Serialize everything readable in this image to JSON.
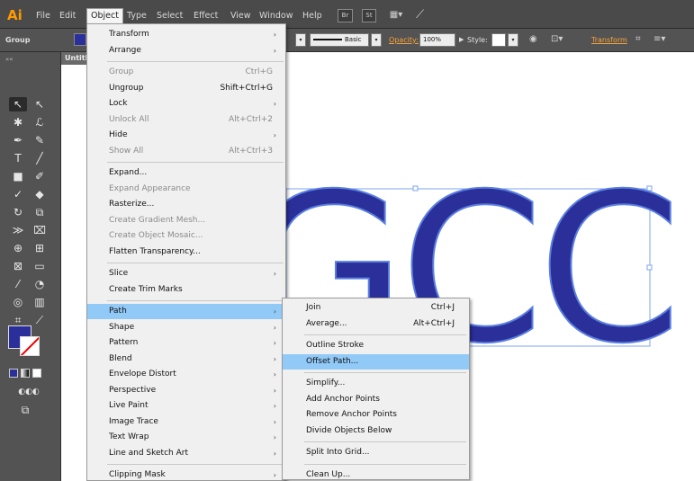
{
  "app": {
    "logo": "Ai"
  },
  "menubar": {
    "items": [
      "File",
      "Edit",
      "Object",
      "Type",
      "Select",
      "Effect",
      "View",
      "Window",
      "Help"
    ],
    "active": "Object",
    "bridge_label": "Br",
    "stock_label": "St",
    "arrange_label": "▦▾",
    "brush_icon": "feather-icon"
  },
  "controlbar": {
    "selection_type": "Group",
    "stroke_style_label": "Basic",
    "opacity_label": "Opacity:",
    "opacity_value": "100%",
    "style_label": "Style:",
    "transform_label": "Transform"
  },
  "document": {
    "tab_title": "Untitled"
  },
  "artwork": {
    "text": "GCC",
    "fill_color": "#2b2f99",
    "stroke_color": "#5a7fe0"
  },
  "object_menu": {
    "items": [
      {
        "label": "Transform",
        "submenu": true
      },
      {
        "label": "Arrange",
        "submenu": true
      },
      {
        "separator": true
      },
      {
        "label": "Group",
        "shortcut": "Ctrl+G",
        "disabled": true
      },
      {
        "label": "Ungroup",
        "shortcut": "Shift+Ctrl+G"
      },
      {
        "label": "Lock",
        "submenu": true
      },
      {
        "label": "Unlock All",
        "shortcut": "Alt+Ctrl+2",
        "disabled": true
      },
      {
        "label": "Hide",
        "submenu": true
      },
      {
        "label": "Show All",
        "shortcut": "Alt+Ctrl+3",
        "disabled": true
      },
      {
        "separator": true
      },
      {
        "label": "Expand..."
      },
      {
        "label": "Expand Appearance",
        "disabled": true
      },
      {
        "label": "Rasterize..."
      },
      {
        "label": "Create Gradient Mesh...",
        "disabled": true
      },
      {
        "label": "Create Object Mosaic...",
        "disabled": true
      },
      {
        "label": "Flatten Transparency..."
      },
      {
        "separator": true
      },
      {
        "label": "Slice",
        "submenu": true
      },
      {
        "label": "Create Trim Marks"
      },
      {
        "separator": true
      },
      {
        "label": "Path",
        "submenu": true,
        "highlight": true
      },
      {
        "label": "Shape",
        "submenu": true
      },
      {
        "label": "Pattern",
        "submenu": true
      },
      {
        "label": "Blend",
        "submenu": true
      },
      {
        "label": "Envelope Distort",
        "submenu": true
      },
      {
        "label": "Perspective",
        "submenu": true
      },
      {
        "label": "Live Paint",
        "submenu": true
      },
      {
        "label": "Image Trace",
        "submenu": true
      },
      {
        "label": "Text Wrap",
        "submenu": true
      },
      {
        "label": "Line and Sketch Art",
        "submenu": true
      },
      {
        "separator": true
      },
      {
        "label": "Clipping Mask",
        "submenu": true
      }
    ]
  },
  "path_submenu": {
    "items": [
      {
        "label": "Join",
        "shortcut": "Ctrl+J"
      },
      {
        "label": "Average...",
        "shortcut": "Alt+Ctrl+J"
      },
      {
        "separator": true
      },
      {
        "label": "Outline Stroke"
      },
      {
        "label": "Offset Path...",
        "highlight": true
      },
      {
        "separator": true
      },
      {
        "label": "Simplify..."
      },
      {
        "label": "Add Anchor Points"
      },
      {
        "label": "Remove Anchor Points"
      },
      {
        "label": "Divide Objects Below"
      },
      {
        "separator": true
      },
      {
        "label": "Split Into Grid..."
      },
      {
        "separator": true
      },
      {
        "label": "Clean Up..."
      }
    ]
  }
}
